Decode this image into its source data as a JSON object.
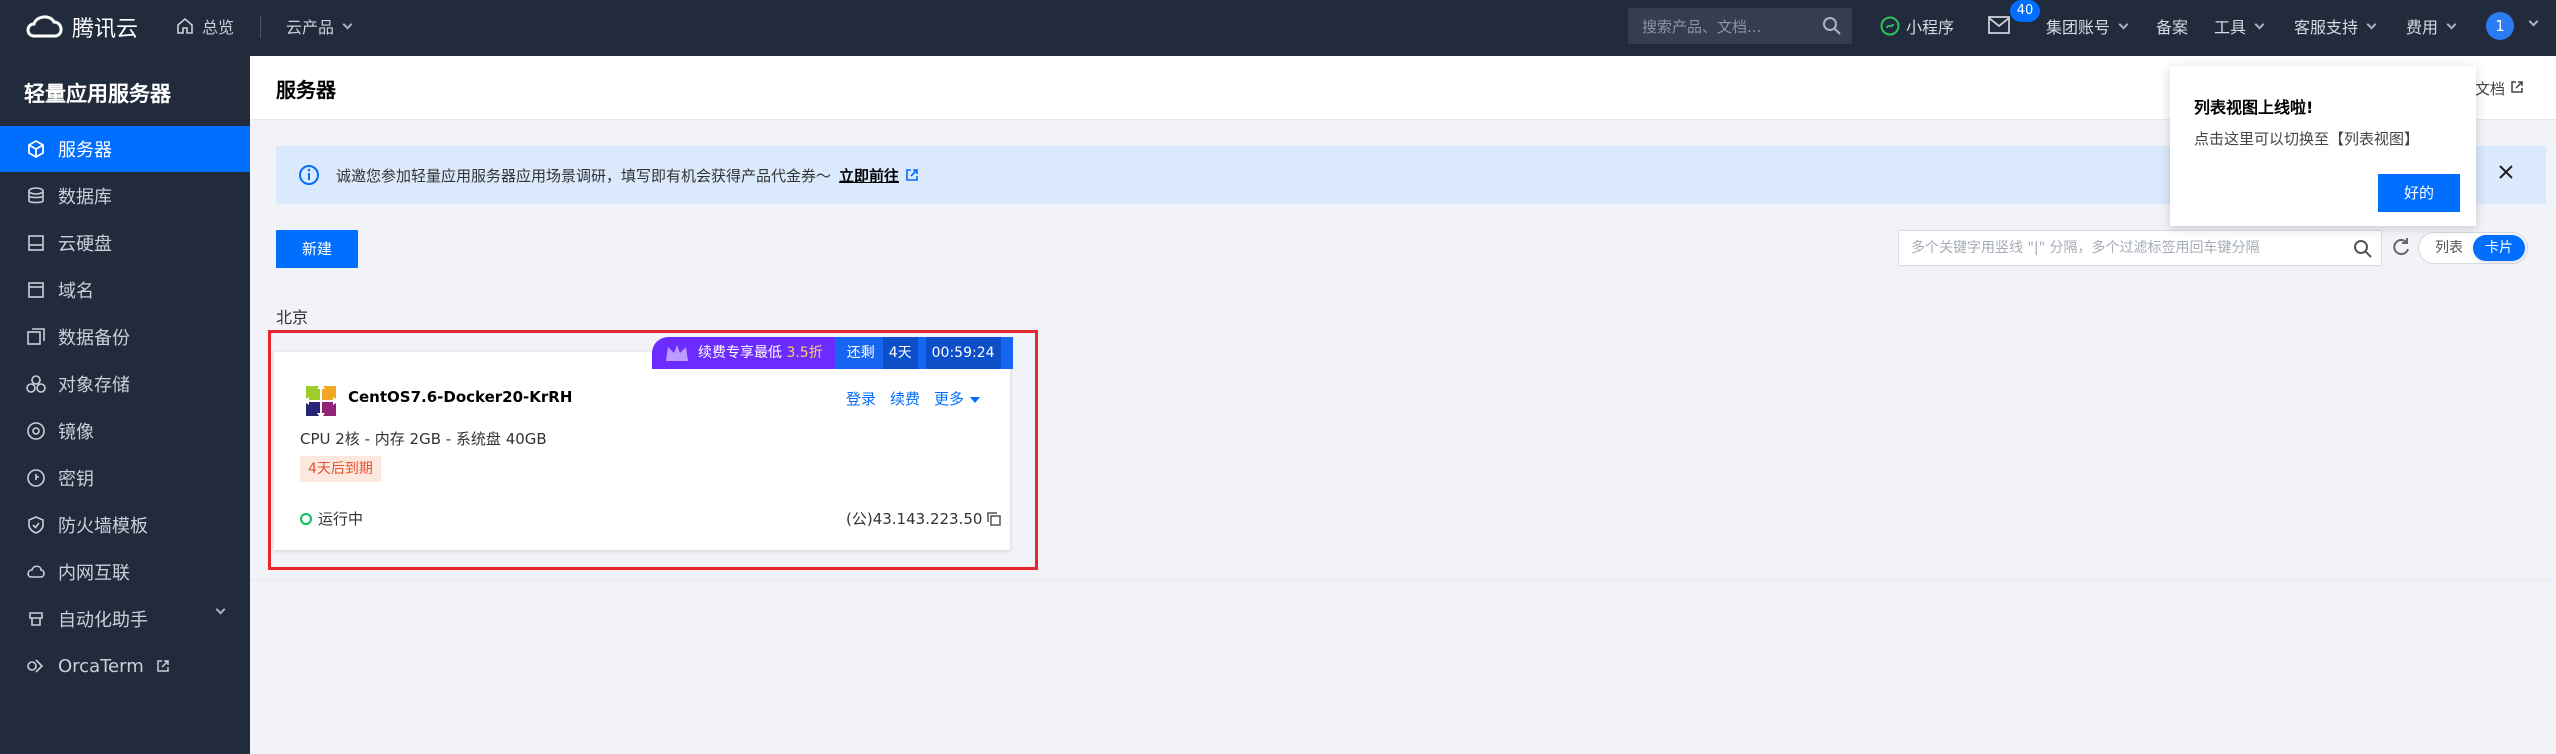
{
  "topnav": {
    "brand": "腾讯云",
    "home": "总览",
    "products": "云产品",
    "search_placeholder": "搜索产品、文档...",
    "mini_program": "小程序",
    "mail_badge": "40",
    "account": "集团账号",
    "beian": "备案",
    "tools": "工具",
    "support": "客服支持",
    "billing": "费用",
    "avatar": "1"
  },
  "sidebar": {
    "title": "轻量应用服务器",
    "items": [
      {
        "label": "服务器",
        "icon": "cube-icon"
      },
      {
        "label": "数据库",
        "icon": "database-icon"
      },
      {
        "label": "云硬盘",
        "icon": "disk-icon"
      },
      {
        "label": "域名",
        "icon": "domain-icon"
      },
      {
        "label": "数据备份",
        "icon": "backup-icon"
      },
      {
        "label": "对象存储",
        "icon": "storage-icon"
      },
      {
        "label": "镜像",
        "icon": "image-icon"
      },
      {
        "label": "密钥",
        "icon": "key-icon"
      },
      {
        "label": "防火墙模板",
        "icon": "shield-icon"
      },
      {
        "label": "内网互联",
        "icon": "network-icon"
      },
      {
        "label": "自动化助手",
        "icon": "automation-icon"
      },
      {
        "label": "OrcaTerm",
        "icon": "terminal-icon"
      }
    ]
  },
  "main": {
    "page_title": "服务器",
    "help_doc": "助文档",
    "notice_text": "诚邀您参加轻量应用服务器应用场景调研，填写即有机会获得产品代金券～",
    "notice_link": "立即前往",
    "new_button": "新建",
    "filter_placeholder": "多个关键字用竖线 \"|\" 分隔，多个过滤标签用回车键分隔",
    "view_list": "列表",
    "view_card": "卡片",
    "region": "北京"
  },
  "promo": {
    "label": "续费专享最低",
    "discount": "3.5折",
    "remaining": "还剩",
    "days": "4天",
    "time": "00:59:24"
  },
  "server": {
    "name": "CentOS7.6-Docker20-KrRH",
    "login": "登录",
    "renew": "续费",
    "more": "更多",
    "spec": "CPU 2核 - 内存 2GB - 系统盘 40GB",
    "expire": "4天后到期",
    "status": "运行中",
    "ip": "(公)43.143.223.50"
  },
  "tooltip": {
    "title": "列表视图上线啦!",
    "text": "点击这里可以切换至【列表视图】",
    "button": "好的"
  },
  "colors": {
    "topnav_bg": "#212b3b",
    "accent": "#006eff",
    "notice_bg": "#dbe9fc",
    "running": "#0abf5b",
    "highlight_frame": "#e8262d"
  }
}
